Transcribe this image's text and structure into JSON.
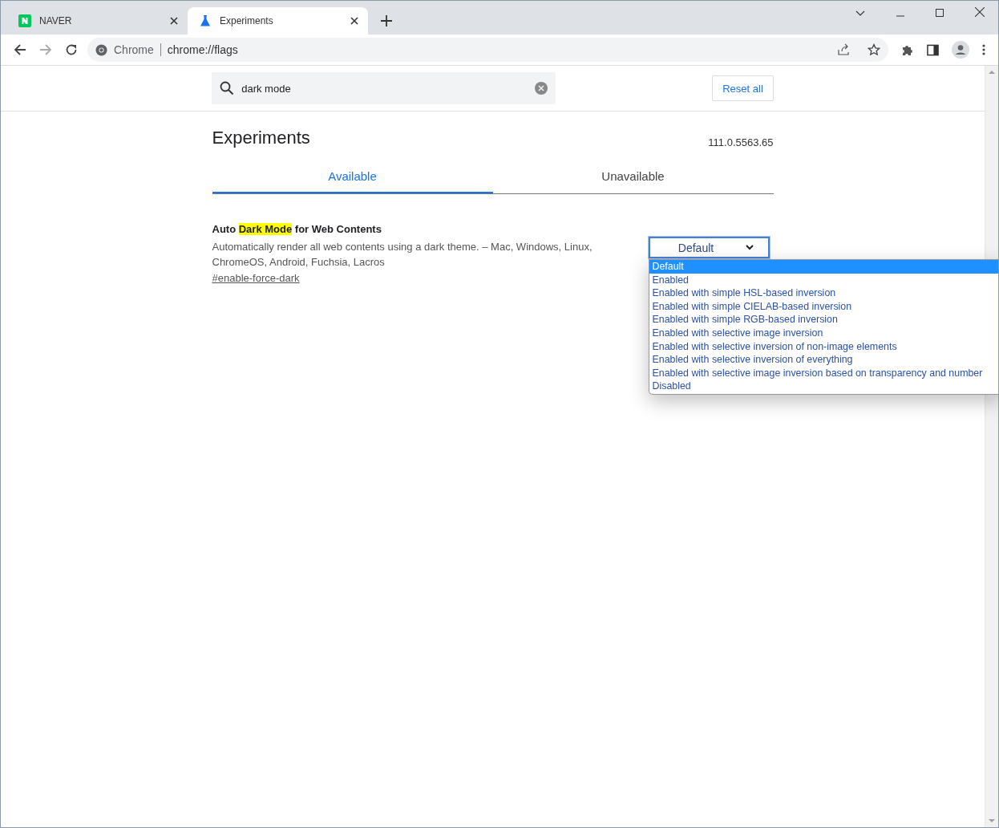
{
  "tabs": [
    {
      "title": "NAVER",
      "kind": "naver",
      "selected": false
    },
    {
      "title": "Experiments",
      "kind": "flask",
      "selected": true
    }
  ],
  "omnibox": {
    "site_label": "Chrome",
    "url": "chrome://flags"
  },
  "search": {
    "value": "dark mode"
  },
  "reset_button": "Reset all",
  "page_title": "Experiments",
  "version": "111.0.5563.65",
  "content_tabs": [
    {
      "label": "Available",
      "selected": true
    },
    {
      "label": "Unavailable",
      "selected": false
    }
  ],
  "flag": {
    "title_parts": [
      {
        "text": "Auto ",
        "highlighted": false
      },
      {
        "text": "Dark Mode",
        "highlighted": true
      },
      {
        "text": " for Web Contents",
        "highlighted": false
      }
    ],
    "description": "Automatically render all web contents using a dark theme. – Mac, Windows, Linux, ChromeOS, Android, Fuchsia, Lacros",
    "link": "#enable-force-dark",
    "select_value": "Default",
    "options": [
      {
        "label": "Default",
        "selected": true
      },
      {
        "label": "Enabled",
        "selected": false
      },
      {
        "label": "Enabled with simple HSL-based inversion",
        "selected": false
      },
      {
        "label": "Enabled with simple CIELAB-based inversion",
        "selected": false
      },
      {
        "label": "Enabled with simple RGB-based inversion",
        "selected": false
      },
      {
        "label": "Enabled with selective image inversion",
        "selected": false
      },
      {
        "label": "Enabled with selective inversion of non-image elements",
        "selected": false
      },
      {
        "label": "Enabled with selective inversion of everything",
        "selected": false
      },
      {
        "label": "Enabled with selective image inversion based on transparency and number",
        "selected": false
      },
      {
        "label": "Disabled",
        "selected": false
      }
    ]
  }
}
